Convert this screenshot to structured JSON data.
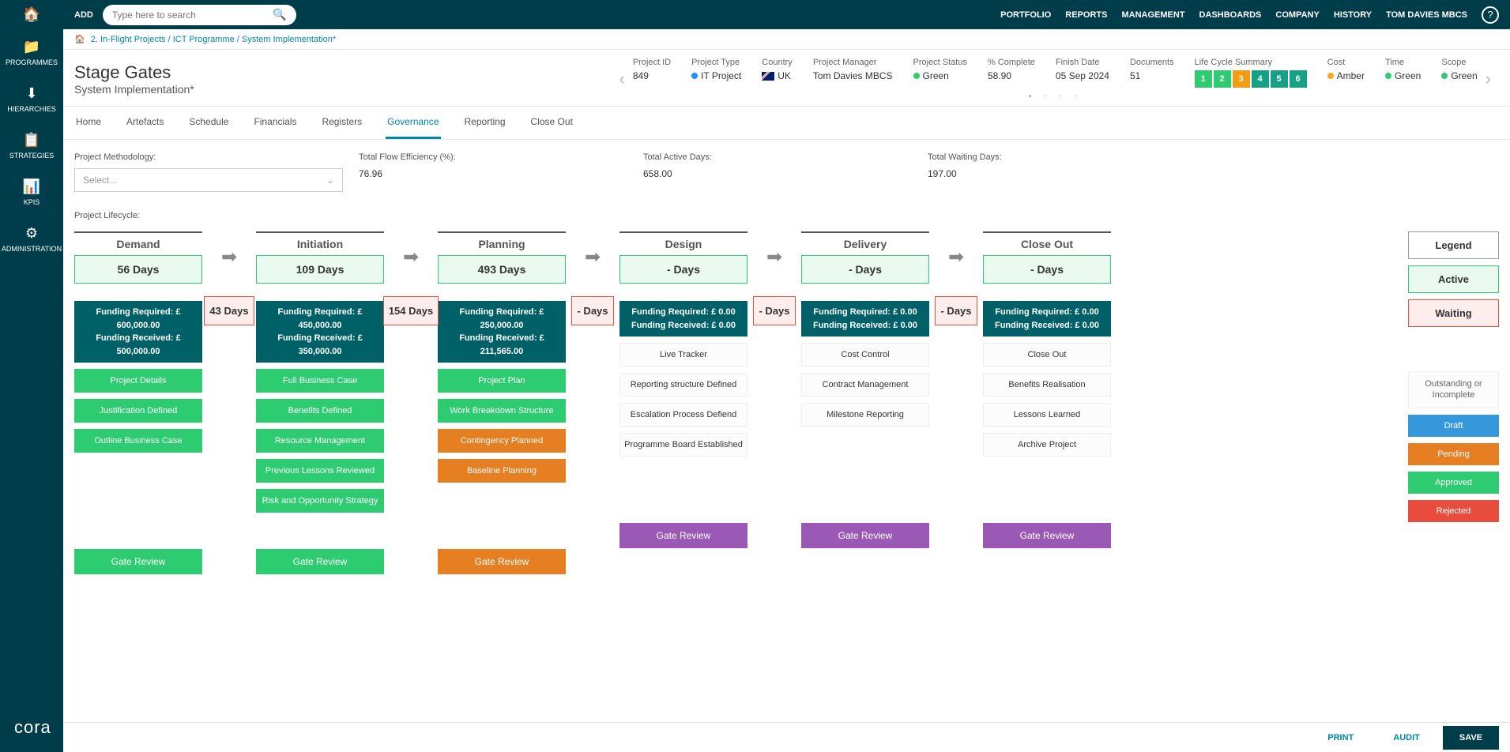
{
  "sidebar": {
    "items": [
      {
        "label": "PROGRAMMES",
        "icon": "📁"
      },
      {
        "label": "HIERARCHIES",
        "icon": "⬇"
      },
      {
        "label": "STRATEGIES",
        "icon": "📋"
      },
      {
        "label": "KPIS",
        "icon": "📊"
      },
      {
        "label": "ADMINISTRATION",
        "icon": "⚙"
      }
    ],
    "logo": "cora"
  },
  "topbar": {
    "add": "ADD",
    "search_placeholder": "Type here to search",
    "nav": [
      "PORTFOLIO",
      "REPORTS",
      "MANAGEMENT",
      "DASHBOARDS",
      "COMPANY",
      "HISTORY",
      "TOM DAVIES MBCS"
    ]
  },
  "breadcrumb": "2. In-Flight Projects / ICT Programme / System Implementation*",
  "header": {
    "title": "Stage Gates",
    "subtitle": "System Implementation*",
    "meta": {
      "project_id_lbl": "Project ID",
      "project_id": "849",
      "project_type_lbl": "Project Type",
      "project_type": "IT Project",
      "country_lbl": "Country",
      "country": "UK",
      "pm_lbl": "Project Manager",
      "pm": "Tom Davies MBCS",
      "status_lbl": "Project Status",
      "status": "Green",
      "complete_lbl": "% Complete",
      "complete": "58.90",
      "finish_lbl": "Finish Date",
      "finish": "05 Sep 2024",
      "docs_lbl": "Documents",
      "docs": "51",
      "lcs_lbl": "Life Cycle Summary",
      "cost_lbl": "Cost",
      "cost": "Amber",
      "time_lbl": "Time",
      "time": "Green",
      "scope_lbl": "Scope",
      "scope": "Green"
    }
  },
  "tabs": [
    "Home",
    "Artefacts",
    "Schedule",
    "Financials",
    "Registers",
    "Governance",
    "Reporting",
    "Close Out"
  ],
  "filters": {
    "method_lbl": "Project Methodology:",
    "method_placeholder": "Select...",
    "flow_lbl": "Total Flow Efficiency (%):",
    "flow": "76.96",
    "active_lbl": "Total Active Days:",
    "active": "658.00",
    "wait_lbl": "Total Waiting Days:",
    "wait": "197.00"
  },
  "lifecycle_lbl": "Project Lifecycle:",
  "stages": [
    {
      "title": "Demand",
      "days": "56 Days",
      "wait_after": "43 Days",
      "fr": "Funding Required: £ 600,000.00",
      "frec": "Funding Received: £ 500,000.00",
      "items": [
        {
          "t": "Project Details",
          "s": "approved"
        },
        {
          "t": "Justification Defined",
          "s": "approved"
        },
        {
          "t": "Outline Business Case",
          "s": "approved"
        }
      ],
      "gate": "Gate Review",
      "gcol": "g"
    },
    {
      "title": "Initiation",
      "days": "109 Days",
      "wait_after": "154 Days",
      "fr": "Funding Required: £ 450,000.00",
      "frec": "Funding Received: £ 350,000.00",
      "items": [
        {
          "t": "Full Business Case",
          "s": "approved"
        },
        {
          "t": "Benefits Defined",
          "s": "approved"
        },
        {
          "t": "Resource Management",
          "s": "approved"
        },
        {
          "t": "Previous Lessons Reviewed",
          "s": "approved"
        },
        {
          "t": "Risk and Opportunity Strategy",
          "s": "approved"
        }
      ],
      "gate": "Gate Review",
      "gcol": "g"
    },
    {
      "title": "Planning",
      "days": "493 Days",
      "wait_after": "- Days",
      "fr": "Funding Required: £ 250,000.00",
      "frec": "Funding Received: £ 211,565.00",
      "items": [
        {
          "t": "Project Plan",
          "s": "approved"
        },
        {
          "t": "Work Breakdown Structure",
          "s": "approved"
        },
        {
          "t": "Contingency Planned",
          "s": "pending"
        },
        {
          "t": "Baseline Planning",
          "s": "pending"
        }
      ],
      "gate": "Gate Review",
      "gcol": "o"
    },
    {
      "title": "Design",
      "days": "- Days",
      "wait_after": "- Days",
      "fr": "Funding Required: £ 0.00",
      "frec": "Funding Received: £ 0.00",
      "items": [
        {
          "t": "Live Tracker",
          "s": "outstanding"
        },
        {
          "t": "Reporting structure Defined",
          "s": "outstanding"
        },
        {
          "t": "Escalation Process Defiend",
          "s": "outstanding"
        },
        {
          "t": "Programme Board Established",
          "s": "outstanding"
        }
      ],
      "gate": "Gate Review",
      "gcol": "p"
    },
    {
      "title": "Delivery",
      "days": "- Days",
      "wait_after": "- Days",
      "fr": "Funding Required: £ 0.00",
      "frec": "Funding Received: £ 0.00",
      "items": [
        {
          "t": "Cost Control",
          "s": "outstanding"
        },
        {
          "t": "Contract Management",
          "s": "outstanding"
        },
        {
          "t": "Milestone Reporting",
          "s": "outstanding"
        }
      ],
      "gate": "Gate Review",
      "gcol": "p"
    },
    {
      "title": "Close Out",
      "days": "- Days",
      "wait_after": "",
      "fr": "Funding Required: £ 0.00",
      "frec": "Funding Received: £ 0.00",
      "items": [
        {
          "t": "Close Out",
          "s": "outstanding"
        },
        {
          "t": "Benefits Realisation",
          "s": "outstanding"
        },
        {
          "t": "Lessons Learned",
          "s": "outstanding"
        },
        {
          "t": "Archive Project",
          "s": "outstanding"
        }
      ],
      "gate": "Gate Review",
      "gcol": "p"
    }
  ],
  "legend": {
    "head": "Legend",
    "active": "Active",
    "waiting": "Waiting",
    "out": "Outstanding or Incomplete",
    "draft": "Draft",
    "pending": "Pending",
    "approved": "Approved",
    "rejected": "Rejected"
  },
  "footer": {
    "print": "PRINT",
    "audit": "AUDIT",
    "save": "SAVE"
  }
}
